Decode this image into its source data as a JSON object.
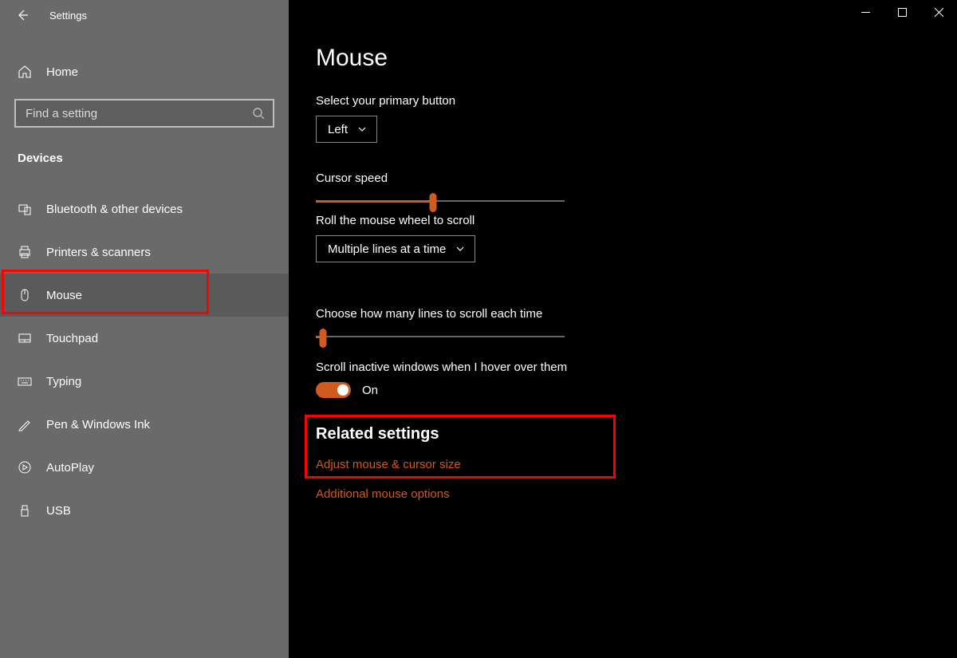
{
  "app_title": "Settings",
  "home_label": "Home",
  "search_placeholder": "Find a setting",
  "category": "Devices",
  "nav": [
    {
      "label": "Bluetooth & other devices"
    },
    {
      "label": "Printers & scanners"
    },
    {
      "label": "Mouse"
    },
    {
      "label": "Touchpad"
    },
    {
      "label": "Typing"
    },
    {
      "label": "Pen & Windows Ink"
    },
    {
      "label": "AutoPlay"
    },
    {
      "label": "USB"
    }
  ],
  "page_title": "Mouse",
  "primary_button": {
    "label": "Select your primary button",
    "value": "Left"
  },
  "cursor_speed": {
    "label": "Cursor speed",
    "percent": 47
  },
  "wheel_scroll": {
    "label": "Roll the mouse wheel to scroll",
    "value": "Multiple lines at a time"
  },
  "lines_scroll": {
    "label": "Choose how many lines to scroll each time",
    "percent": 3
  },
  "scroll_inactive": {
    "label": "Scroll inactive windows when I hover over them",
    "state": "On"
  },
  "related": {
    "heading": "Related settings",
    "links": [
      "Adjust mouse & cursor size",
      "Additional mouse options"
    ]
  }
}
